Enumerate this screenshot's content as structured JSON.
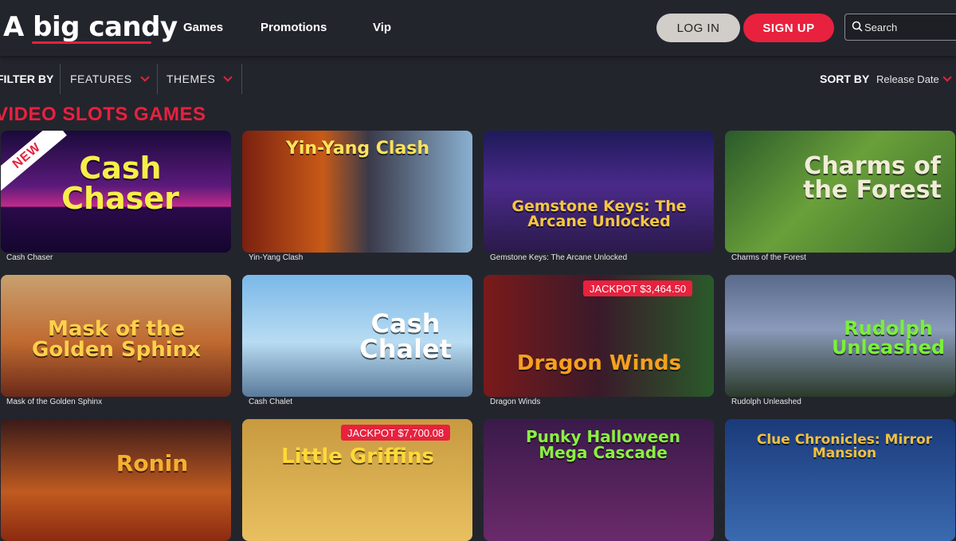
{
  "header": {
    "logo": "A big candy",
    "nav": [
      "Games",
      "Promotions",
      "Vip"
    ],
    "login": "LOG IN",
    "signup": "SIGN UP",
    "search_placeholder": "Search"
  },
  "filters": {
    "filter_by": "FILTER BY",
    "features": "FEATURES",
    "themes": "THEMES",
    "sort_by": "SORT BY",
    "sort_value": "Release Date"
  },
  "section_title": "VIDEO SLOTS GAMES",
  "games": [
    {
      "name": "Cash Chaser",
      "art_title": "Cash Chaser",
      "badge": "NEW",
      "jackpot": ""
    },
    {
      "name": "Yin-Yang Clash",
      "art_title": "Yin-Yang Clash",
      "badge": "",
      "jackpot": ""
    },
    {
      "name": "Gemstone Keys: The Arcane Unlocked",
      "art_title": "Gemstone Keys: The Arcane Unlocked",
      "badge": "",
      "jackpot": ""
    },
    {
      "name": "Charms of the Forest",
      "art_title": "Charms of the Forest",
      "badge": "",
      "jackpot": ""
    },
    {
      "name": "Mask of the Golden Sphinx",
      "art_title": "Mask of the Golden Sphinx",
      "badge": "",
      "jackpot": ""
    },
    {
      "name": "Cash Chalet",
      "art_title": "Cash Chalet",
      "badge": "",
      "jackpot": ""
    },
    {
      "name": "Dragon Winds",
      "art_title": "Dragon Winds",
      "badge": "",
      "jackpot": "JACKPOT $3,464.50"
    },
    {
      "name": "Rudolph Unleashed",
      "art_title": "Rudolph Unleashed",
      "badge": "",
      "jackpot": ""
    },
    {
      "name": "",
      "art_title": "Ronin",
      "badge": "",
      "jackpot": ""
    },
    {
      "name": "",
      "art_title": "Little Griffins",
      "badge": "",
      "jackpot": "JACKPOT $7,700.08"
    },
    {
      "name": "",
      "art_title": "Punky Halloween Mega Cascade",
      "badge": "",
      "jackpot": ""
    },
    {
      "name": "",
      "art_title": "Clue Chronicles: Mirror Mansion",
      "badge": "",
      "jackpot": ""
    }
  ],
  "colors": {
    "accent": "#e8213e",
    "background": "#23252d",
    "login_button": "#d1cdc8"
  }
}
